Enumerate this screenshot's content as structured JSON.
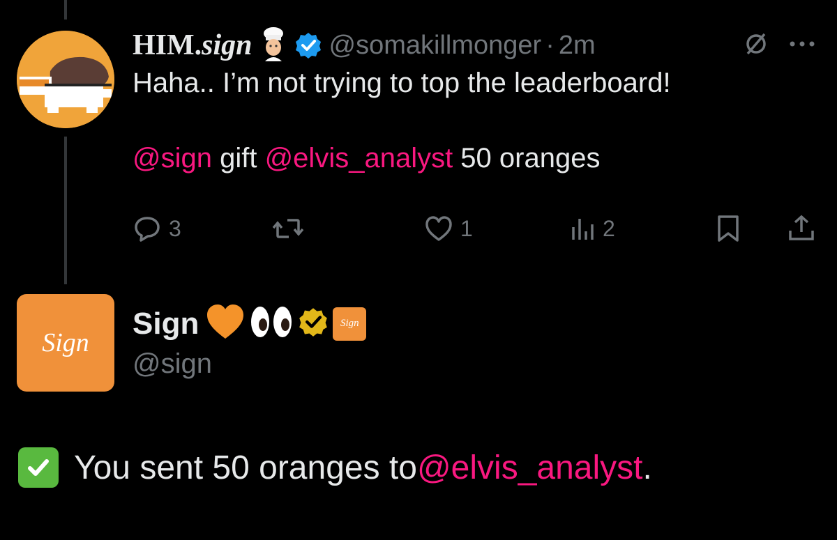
{
  "tweet": {
    "display_name_prefix": "HIM.",
    "display_name_suffix": "sign",
    "handle": "@somakillmonger",
    "separator": "·",
    "time": "2m",
    "text_line1": "Haha.. I’m not trying to top the leaderboard!",
    "mention_sign": "@sign",
    "word_gift": " gift ",
    "mention_elvis": "@elvis_analyst",
    "text_tail": " 50 oranges",
    "actions": {
      "replies": "3",
      "reposts": "",
      "likes": "1",
      "views": "2"
    },
    "icons": [
      "verified-badge-icon",
      "grok-icon",
      "more-icon",
      "reply-icon",
      "repost-icon",
      "like-icon",
      "views-icon",
      "bookmark-icon",
      "share-icon"
    ]
  },
  "sign_profile": {
    "avatar_text": "Sign",
    "display_name": "Sign",
    "emojis": [
      "🧡",
      "👀"
    ],
    "badge_text": "Sign",
    "handle": "@sign"
  },
  "reply": {
    "prefix": "You sent 50 oranges to ",
    "mention": "@elvis_analyst",
    "suffix": "."
  },
  "colors": {
    "background": "#000000",
    "text": "#e7e9ea",
    "muted": "#71767b",
    "mention": "#f91880",
    "brand_orange": "#f0913a",
    "verified_blue": "#1d9bf0",
    "verified_gold": "#e2b719",
    "check_green": "#59b93f"
  }
}
